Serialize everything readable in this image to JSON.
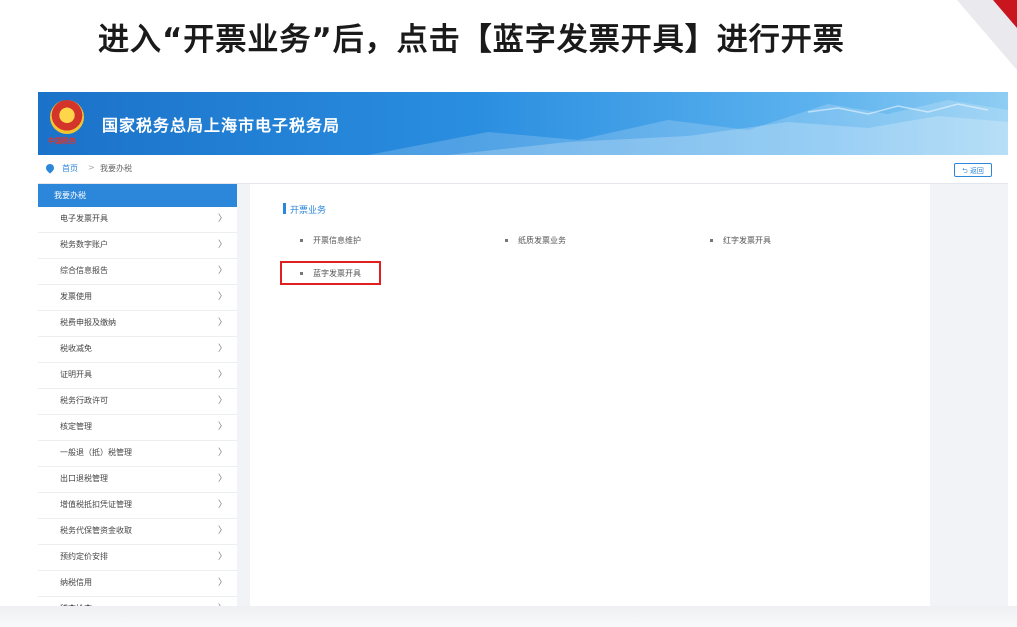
{
  "headline": "进入“开票业务”后，点击【蓝字发票开具】进行开票",
  "banner": {
    "title": "国家税务总局上海市电子税务局",
    "emblem_text": "中国税务"
  },
  "breadcrumb": {
    "home": "首页",
    "separator": ">",
    "current": "我要办税"
  },
  "back_label": "返回",
  "sidebar": {
    "header": "我要办税",
    "items": [
      {
        "label": "电子发票开具"
      },
      {
        "label": "税务数字账户"
      },
      {
        "label": "综合信息报告"
      },
      {
        "label": "发票使用"
      },
      {
        "label": "税费申报及缴纳"
      },
      {
        "label": "税收减免"
      },
      {
        "label": "证明开具"
      },
      {
        "label": "税务行政许可"
      },
      {
        "label": "核定管理"
      },
      {
        "label": "一般退（抵）税管理"
      },
      {
        "label": "出口退税管理"
      },
      {
        "label": "增值税抵扣凭证管理"
      },
      {
        "label": "税务代保管资金收取"
      },
      {
        "label": "预约定价安排"
      },
      {
        "label": "纳税信用"
      },
      {
        "label": "稽查检查"
      }
    ],
    "chevron": "〉"
  },
  "main": {
    "section_title": "开票业务",
    "options": [
      "开票信息维护",
      "纸质发票业务",
      "红字发票开具",
      "蓝字发票开具"
    ]
  },
  "colors": {
    "brand_blue": "#2c86d9",
    "highlight_red": "#e02020",
    "accent_red": "#c9151e"
  }
}
